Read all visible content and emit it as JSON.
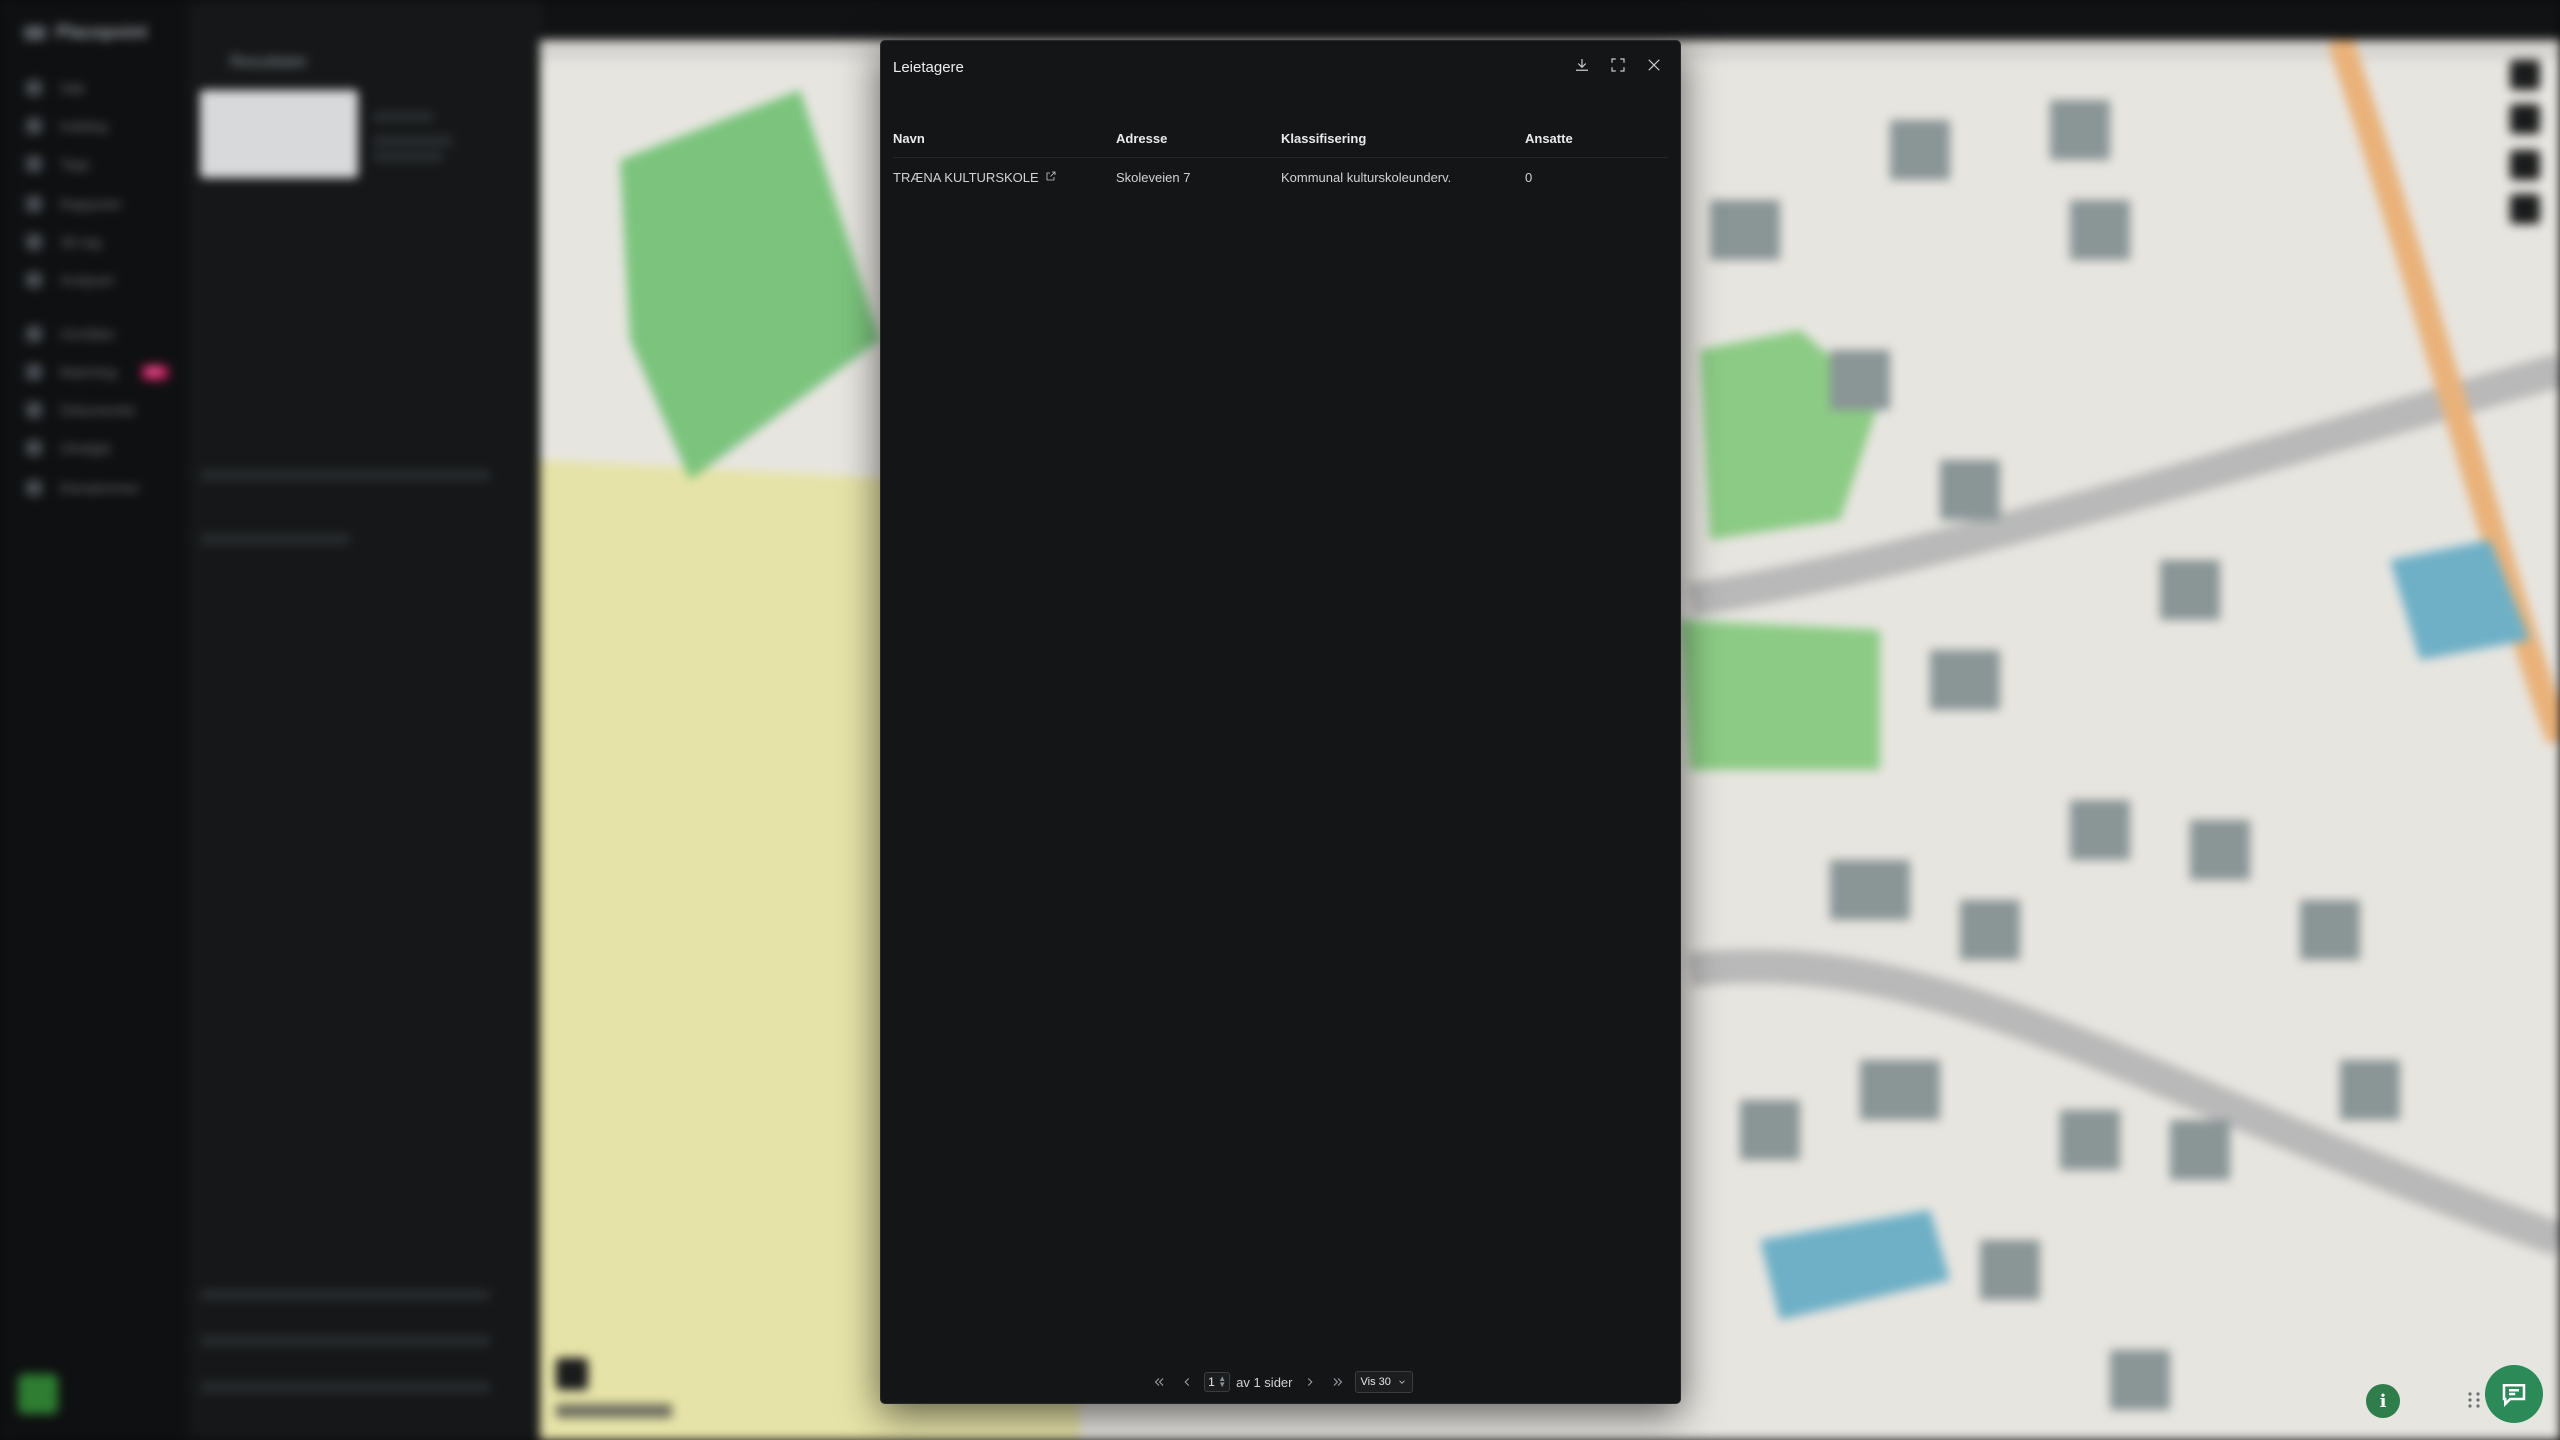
{
  "background": {
    "app_name": "Placepoint",
    "nav_items": [
      "Søk",
      "Katalog",
      "Tags",
      "Rapporter",
      "3D-lag",
      "Analyser",
      "Områder",
      "Matching",
      "Dokumenter",
      "Utvalgte",
      "Eiendommer"
    ],
    "nav_badge": "NY",
    "panel_title": "Resultater"
  },
  "modal": {
    "title": "Leietagere",
    "columns": [
      "Navn",
      "Adresse",
      "Klassifisering",
      "Ansatte"
    ],
    "rows": [
      {
        "navn": "TRÆNA KULTURSKOLE",
        "adresse": "Skoleveien 7",
        "klassifisering": "Kommunal kulturskoleunderv.",
        "ansatte": "0"
      }
    ],
    "pagination": {
      "current_page": "1",
      "of_pages_label": "av 1 sider",
      "per_page_label": "Vis 30"
    }
  },
  "icons": {
    "download": "download-icon",
    "fullscreen": "fullscreen-icon",
    "close": "close-icon",
    "external_link": "external-link-icon",
    "info": "info-icon",
    "chat": "chat-icon"
  },
  "colors": {
    "modal_bg": "#141517",
    "accent_green": "#2b8a57",
    "map_green": "#7cc47e",
    "map_yellow": "#e6e3a8",
    "map_water": "#6fb0c6"
  }
}
